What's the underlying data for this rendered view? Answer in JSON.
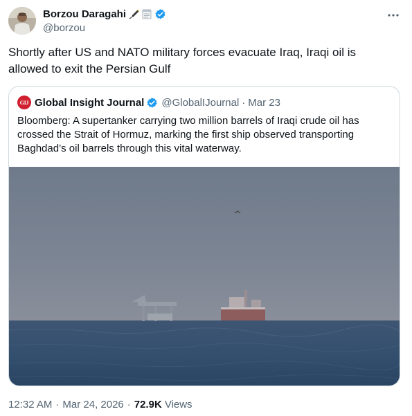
{
  "author": {
    "display_name": "Borzou Daragahi",
    "handle": "@borzou",
    "emoji_icons": [
      "fountain-pen-icon",
      "spiral-notepad-icon"
    ],
    "verified_color": "#1d9bf0"
  },
  "tweet": {
    "text": "Shortly after US and NATO military forces evacuate Iraq, Iraqi oil is allowed to exit the Persian Gulf"
  },
  "quoted": {
    "avatar_text": "GIJ",
    "avatar_color": "#d01f2e",
    "display_name": "Global Insight Journal",
    "handle": "@GlobalIJournal",
    "separator": "·",
    "date": "Mar 23",
    "text": "Bloomberg: A supertanker carrying two million barrels of Iraqi crude oil has crossed the Strait of Hormuz, marking the first ship observed transporting Baghdad’s oil barrels through this vital waterway."
  },
  "footer": {
    "time": "12:32 AM",
    "dot1": "·",
    "date": "Mar 24, 2026",
    "dot2": "·",
    "views_count": "72.9K",
    "views_label": "Views"
  }
}
